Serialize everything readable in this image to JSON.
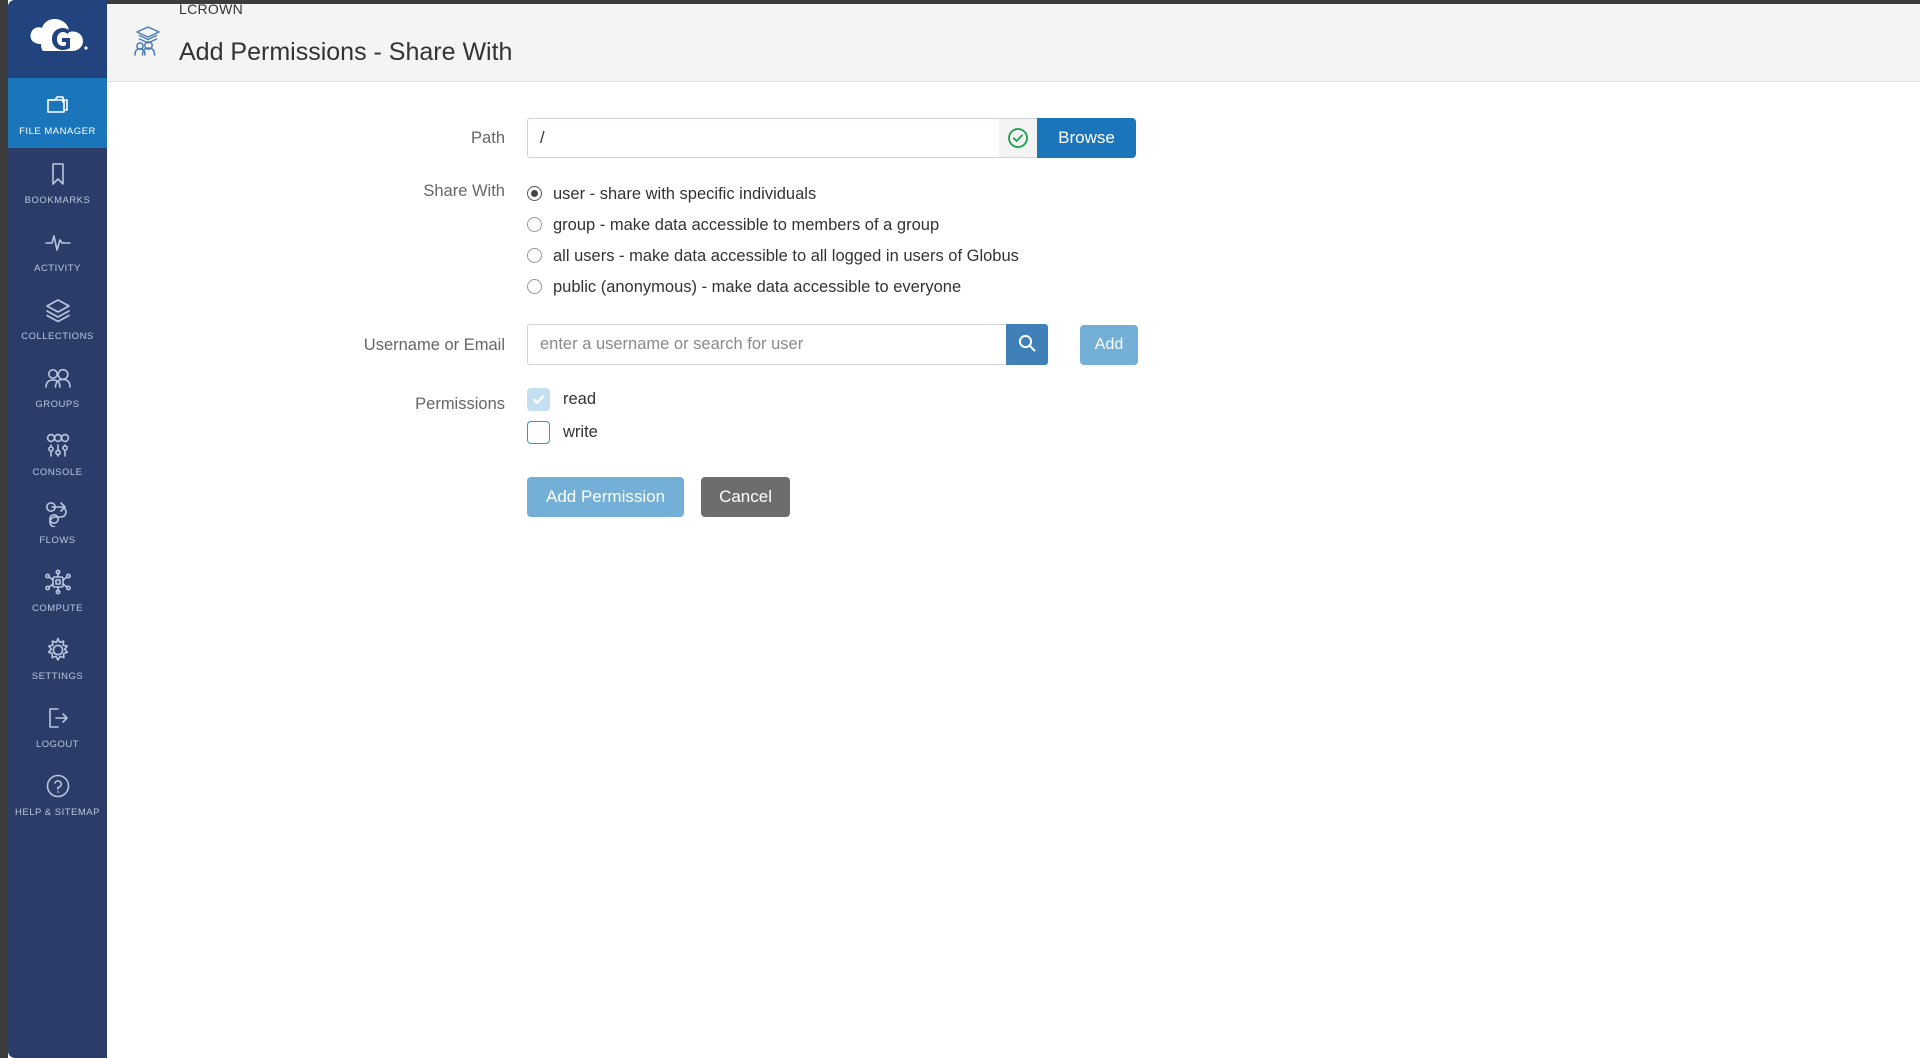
{
  "brand": {
    "logo_icon": "globus-g-cloud-logo",
    "accent_blue": "#1b75bb",
    "sidebar_bg": "#2b3c68",
    "logo_bg": "#21447e",
    "muted_blue": "#74afd8",
    "valid_green": "#1a9e4b",
    "cancel_gray": "#6d6d6d",
    "header_bg": "#f4f4f4"
  },
  "sidebar": {
    "items": [
      {
        "label": "FILE MANAGER",
        "icon": "folder-icon",
        "active": true
      },
      {
        "label": "BOOKMARKS",
        "icon": "bookmark-icon",
        "active": false
      },
      {
        "label": "ACTIVITY",
        "icon": "pulse-icon",
        "active": false
      },
      {
        "label": "COLLECTIONS",
        "icon": "layers-icon",
        "active": false
      },
      {
        "label": "GROUPS",
        "icon": "people-icon",
        "active": false
      },
      {
        "label": "CONSOLE",
        "icon": "sliders-icon",
        "active": false
      },
      {
        "label": "FLOWS",
        "icon": "flow-arrow-icon",
        "active": false
      },
      {
        "label": "COMPUTE",
        "icon": "chip-icon",
        "active": false
      },
      {
        "label": "SETTINGS",
        "icon": "gear-icon",
        "active": false
      },
      {
        "label": "LOGOUT",
        "icon": "logout-icon",
        "active": false
      },
      {
        "label": "HELP & SITEMAP",
        "icon": "question-circle-icon",
        "active": false
      }
    ]
  },
  "header": {
    "icon": "shared-collection-icon",
    "collection_name": "LCROWN",
    "title": "Add Permissions - Share With"
  },
  "form": {
    "path": {
      "label": "Path",
      "value": "/",
      "placeholder": "",
      "valid_icon": "check-circle-icon",
      "browse_label": "Browse"
    },
    "share_with": {
      "label": "Share With",
      "selected": "user",
      "options": [
        {
          "id": "user",
          "label": "user - share with specific individuals"
        },
        {
          "id": "group",
          "label": "group - make data accessible to members of a group"
        },
        {
          "id": "all-users",
          "label": "all users - make data accessible to all logged in users of Globus"
        },
        {
          "id": "public",
          "label": "public (anonymous) - make data accessible to everyone"
        }
      ]
    },
    "username": {
      "label": "Username or Email",
      "value": "",
      "placeholder": "enter a username or search for user",
      "search_icon": "search-icon",
      "add_label": "Add"
    },
    "permissions": {
      "label": "Permissions",
      "options": [
        {
          "id": "read",
          "label": "read",
          "checked": true
        },
        {
          "id": "write",
          "label": "write",
          "checked": false
        }
      ]
    },
    "actions": {
      "submit_label": "Add Permission",
      "cancel_label": "Cancel"
    }
  }
}
